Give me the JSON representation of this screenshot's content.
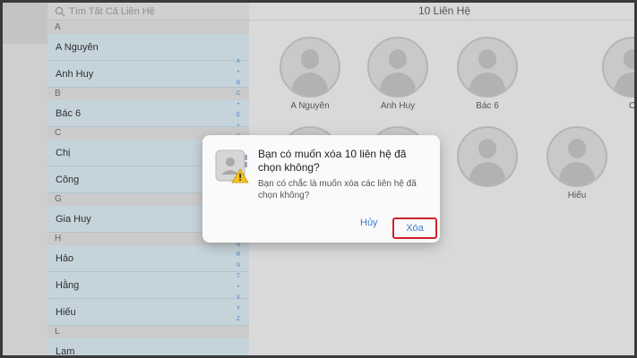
{
  "search": {
    "placeholder": "Tìm Tất Cả Liên Hệ"
  },
  "list": {
    "sections": [
      {
        "letter": "A",
        "contacts": [
          "A Nguyên",
          "Anh Huy"
        ]
      },
      {
        "letter": "B",
        "contacts": [
          "Bác 6"
        ]
      },
      {
        "letter": "C",
        "contacts": [
          "Chị",
          "Công"
        ]
      },
      {
        "letter": "G",
        "contacts": [
          "Gia Huy"
        ]
      },
      {
        "letter": "H",
        "contacts": [
          "Hảo",
          "Hằng",
          "Hiếu"
        ]
      },
      {
        "letter": "L",
        "contacts": [
          "Lam"
        ]
      }
    ],
    "index_letters": [
      "A",
      "•",
      "B",
      "C",
      "•",
      "E",
      "•",
      "G",
      "•",
      "I",
      "•",
      "K",
      "•",
      "M",
      "•",
      "O",
      "•",
      "Q",
      "R",
      "S",
      "T",
      "•",
      "X",
      "Y",
      "Z"
    ]
  },
  "main": {
    "title": "10 Liên Hệ",
    "contacts": [
      {
        "name": "A Nguyên"
      },
      {
        "name": "Anh Huy"
      },
      {
        "name": "Bác 6"
      },
      {
        "name": "C"
      },
      {
        "name": ""
      },
      {
        "name": ""
      },
      {
        "name": ""
      },
      {
        "name": "Hiếu"
      }
    ]
  },
  "dialog": {
    "title": "Bạn có muốn xóa 10 liên hệ đã chọn không?",
    "message": "Bạn có chắc là muốn xóa các liên hệ đã chọn không?",
    "cancel_label": "Hủy",
    "delete_label": "Xóa",
    "icon": "contacts-warning-icon"
  },
  "colors": {
    "accent": "#3a7bd5",
    "highlight_border": "#d0222b",
    "list_selected": "#c5d4db"
  }
}
